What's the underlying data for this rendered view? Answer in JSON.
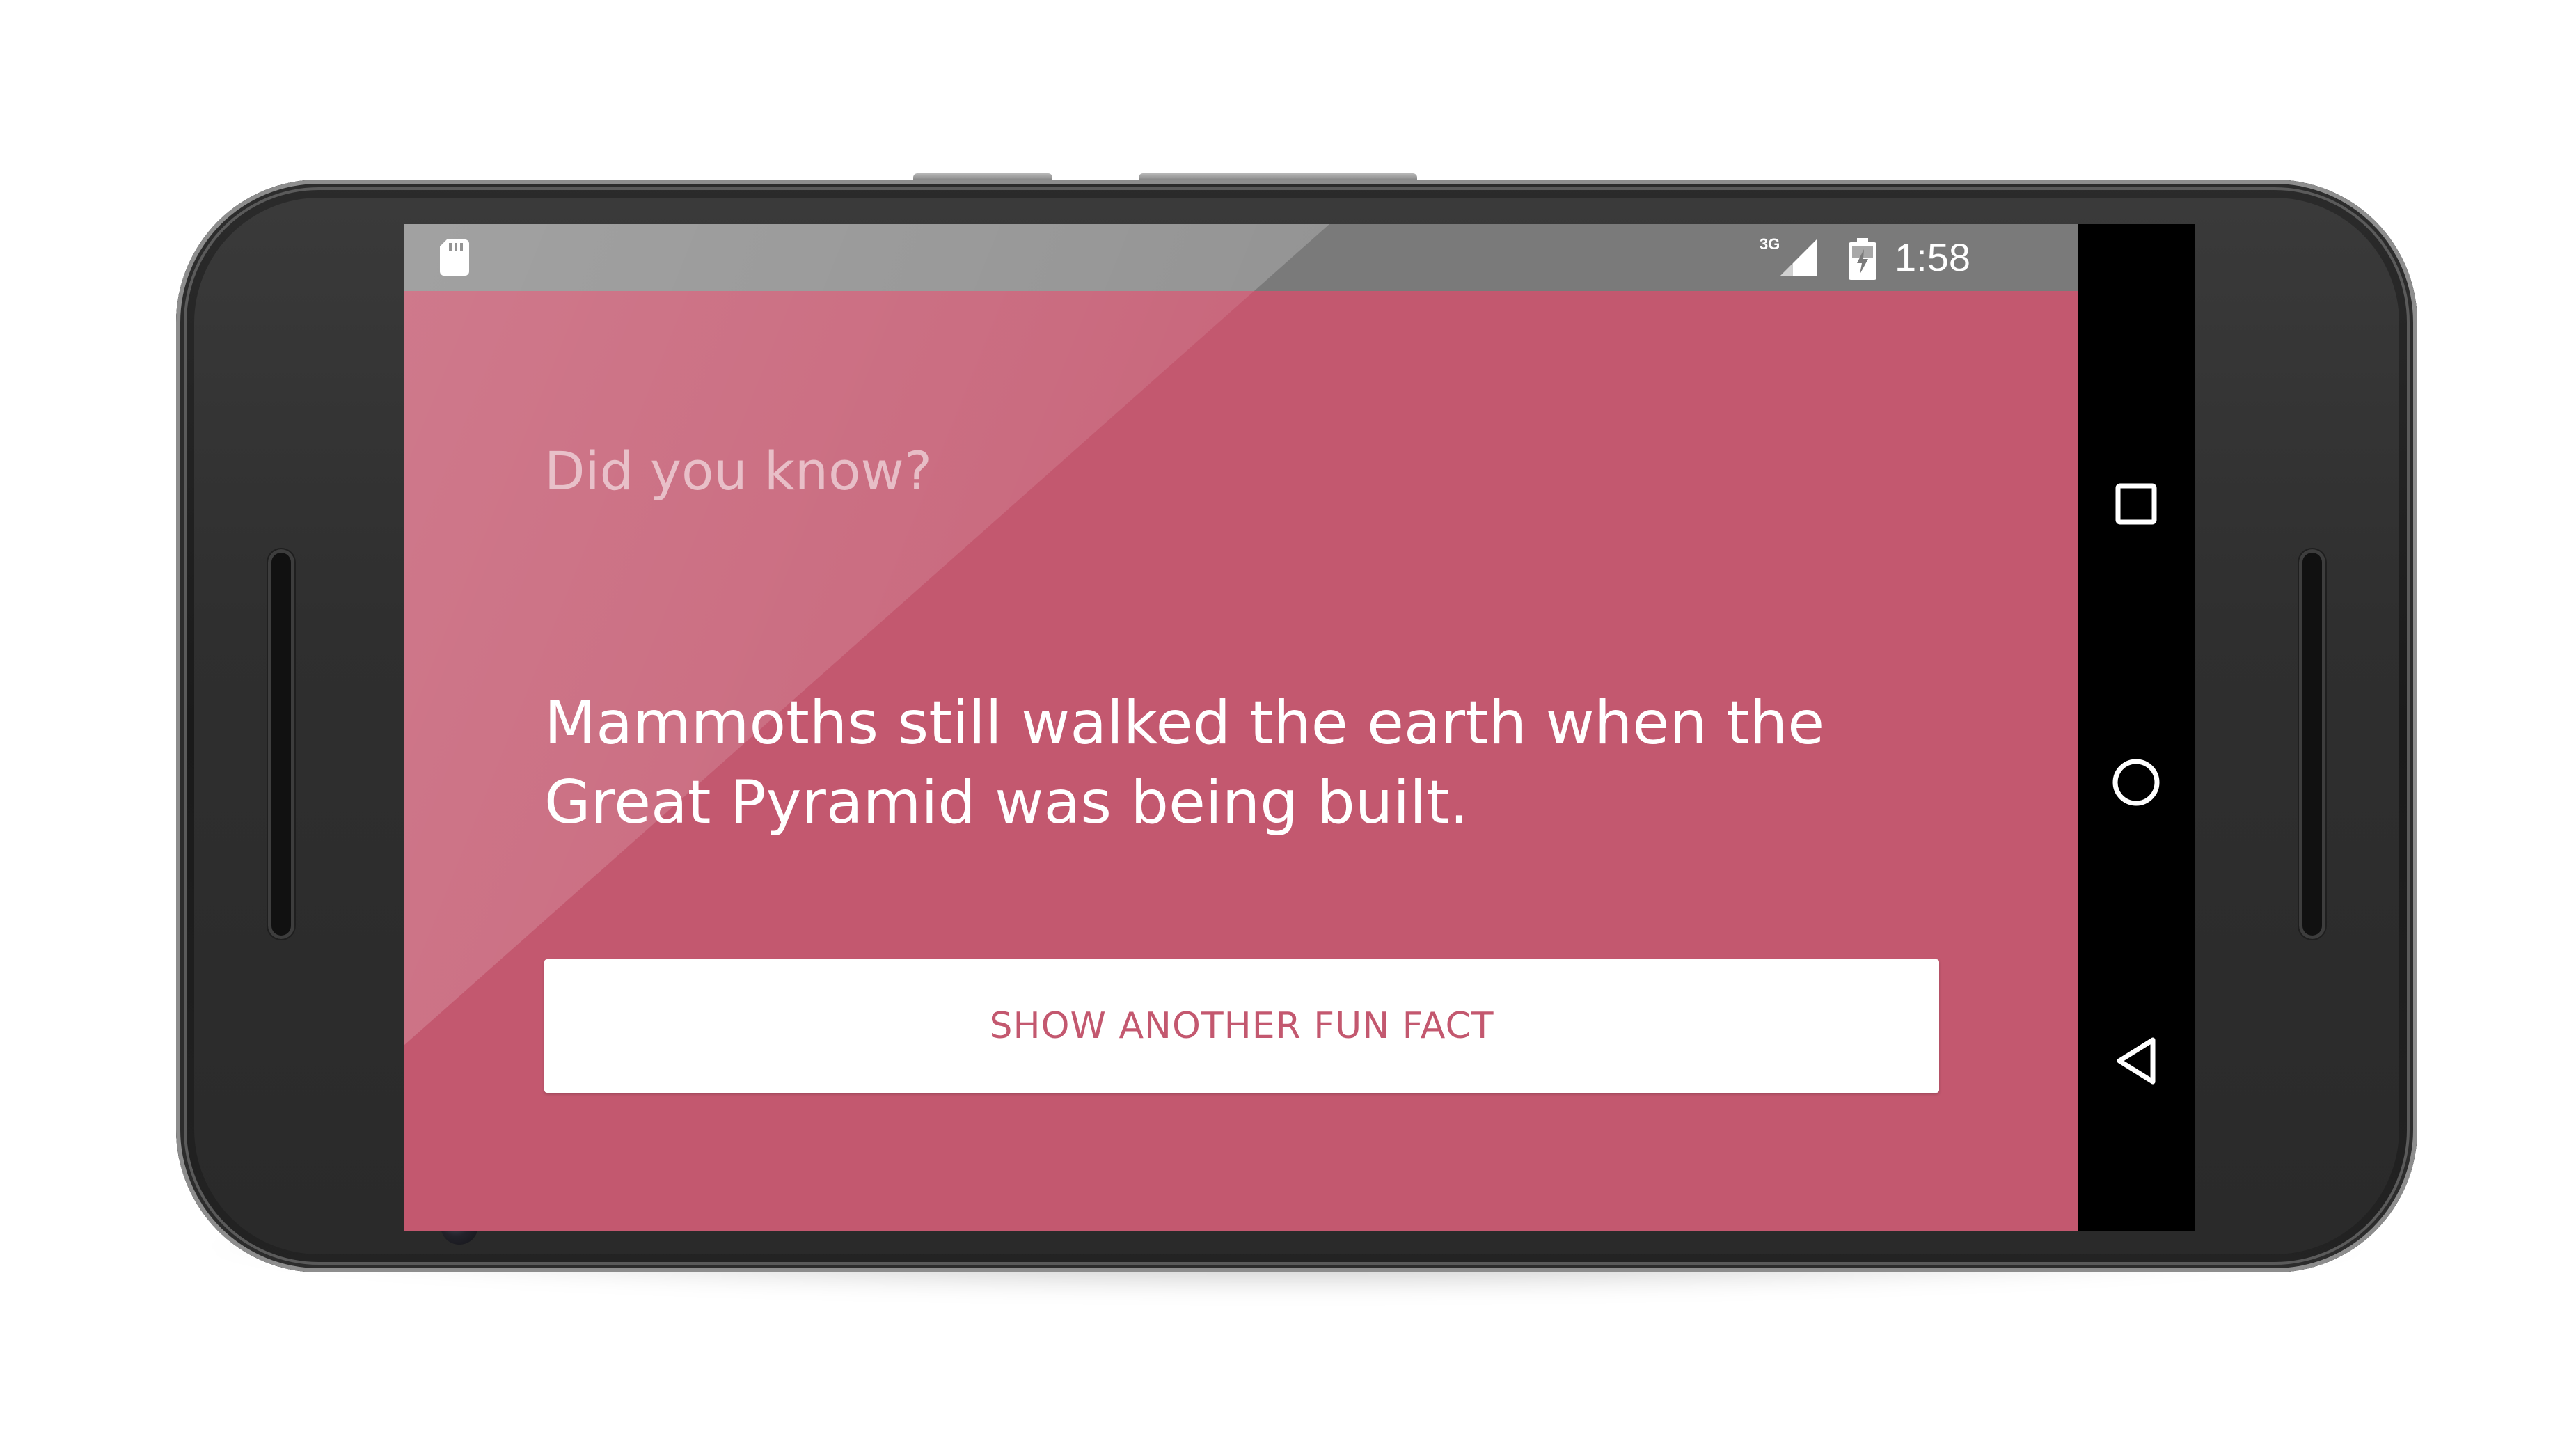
{
  "status_bar": {
    "network_type": "3G",
    "time": "1:58",
    "icons": [
      "sd-card-icon",
      "signal-icon",
      "battery-charging-icon"
    ]
  },
  "app": {
    "background_color": "#c3586f",
    "heading": "Did you know?",
    "fact": "Mammoths still walked the earth when the Great Pyramid was being built.",
    "button_label": "SHOW ANOTHER FUN FACT"
  },
  "nav_bar": {
    "buttons": [
      "recents-icon",
      "home-icon",
      "back-icon"
    ]
  }
}
